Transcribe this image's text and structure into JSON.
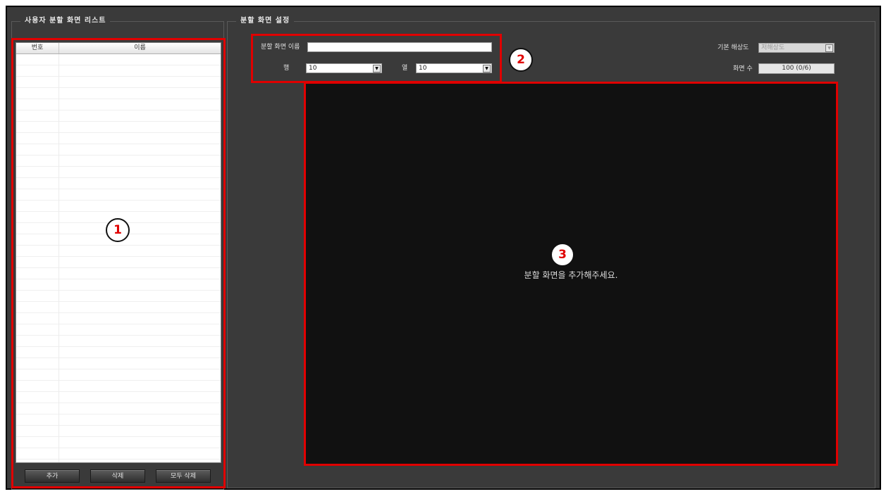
{
  "left_panel": {
    "title": "사용자 분할 화면 리스트",
    "columns": [
      "번호",
      "이름"
    ],
    "buttons": {
      "add": "추가",
      "delete": "삭제",
      "delete_all": "모두 삭제"
    }
  },
  "right_panel": {
    "title": "분할 화면 설정",
    "name_label": "분할 화면 이름",
    "name_value": "",
    "row_label": "행",
    "row_value": "10",
    "col_label": "열",
    "col_value": "10",
    "resolution_label": "기본 해상도",
    "resolution_value": "저해상도",
    "screen_count_label": "화면 수",
    "screen_count_value": "100 (0/6)",
    "empty_message": "분할 화면을 추가해주세요."
  },
  "annotations": {
    "one": "1",
    "two": "2",
    "three": "3",
    "color": "#e00000"
  }
}
